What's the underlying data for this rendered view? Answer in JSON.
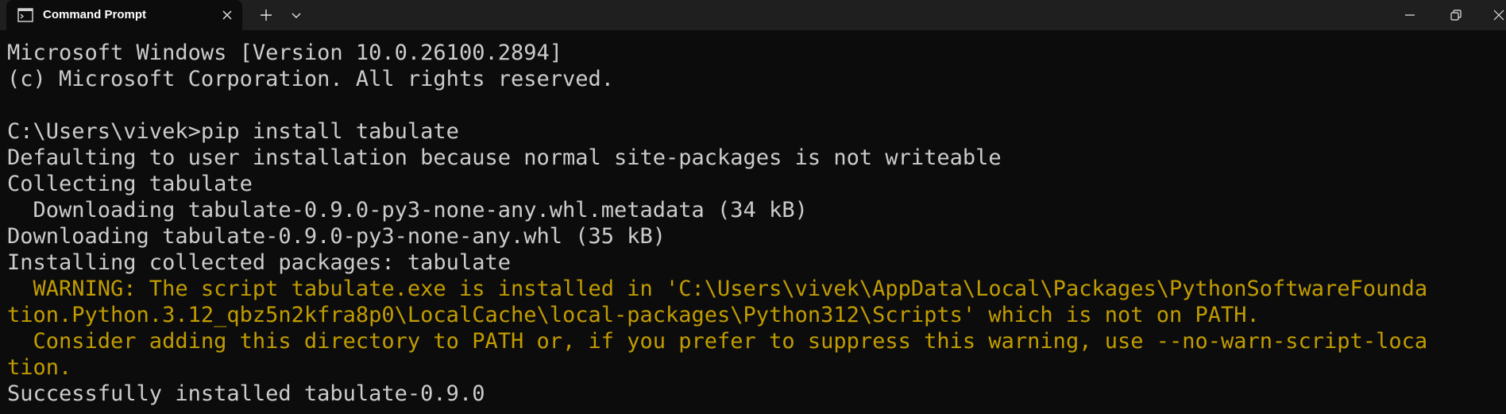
{
  "tab": {
    "title": "Command Prompt",
    "icon": "command-prompt-icon"
  },
  "titlebar_icons": {
    "close_tab": "close-icon",
    "new_tab": "plus-icon",
    "dropdown": "chevron-down-icon",
    "minimize": "minimize-icon",
    "restore": "restore-icon",
    "close_window": "close-icon"
  },
  "colors": {
    "background": "#0c0c0c",
    "titlebar": "#1f1f1f",
    "text": "#cccccc",
    "warning": "#c19c00"
  },
  "terminal": {
    "lines": [
      {
        "text": "Microsoft Windows [Version 10.0.26100.2894]",
        "type": "normal"
      },
      {
        "text": "(c) Microsoft Corporation. All rights reserved.",
        "type": "normal"
      },
      {
        "text": "",
        "type": "normal"
      },
      {
        "text": "C:\\Users\\vivek>pip install tabulate",
        "type": "normal"
      },
      {
        "text": "Defaulting to user installation because normal site-packages is not writeable",
        "type": "normal"
      },
      {
        "text": "Collecting tabulate",
        "type": "normal"
      },
      {
        "text": "  Downloading tabulate-0.9.0-py3-none-any.whl.metadata (34 kB)",
        "type": "normal"
      },
      {
        "text": "Downloading tabulate-0.9.0-py3-none-any.whl (35 kB)",
        "type": "normal"
      },
      {
        "text": "Installing collected packages: tabulate",
        "type": "normal"
      },
      {
        "text": "  WARNING: The script tabulate.exe is installed in 'C:\\Users\\vivek\\AppData\\Local\\Packages\\PythonSoftwareFounda",
        "type": "warning"
      },
      {
        "text": "tion.Python.3.12_qbz5n2kfra8p0\\LocalCache\\local-packages\\Python312\\Scripts' which is not on PATH.",
        "type": "warning"
      },
      {
        "text": "  Consider adding this directory to PATH or, if you prefer to suppress this warning, use --no-warn-script-loca",
        "type": "warning"
      },
      {
        "text": "tion.",
        "type": "warning"
      },
      {
        "text": "Successfully installed tabulate-0.9.0",
        "type": "normal"
      }
    ]
  }
}
